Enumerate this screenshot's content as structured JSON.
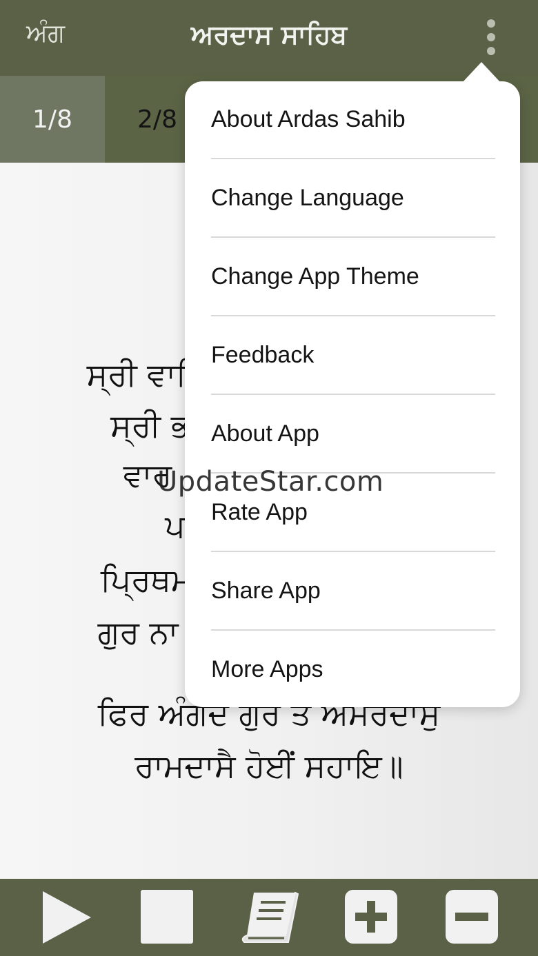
{
  "header": {
    "left_label": "ਅੰਗ",
    "title": "ਅਰਦਾਸ ਸਾਹਿਬ",
    "menu_icon": "more-vertical-icon"
  },
  "tabs": [
    {
      "label": "1/8",
      "active": true
    },
    {
      "label": "2/8",
      "active": false
    }
  ],
  "verse": {
    "lines": [
      "ਸ੍ਰੀ ਵਾਹਿ",
      "ਸ੍ਰੀ ਭ",
      "ਵਾਰ ",
      "ਪ",
      "ਪ੍ਰਿਥਮ",
      "ਗੁਰ ਨਾ",
      "ਫਿਰ ਅੰਗਦ ਗੁਰ ਤੇ ਅਮਰਦਾਸੁ",
      "ਰਾਮਦਾਸੈ ਹੋਈਂ ਸਹਾਇ॥"
    ]
  },
  "watermark": "UpdateStar.com",
  "menu": {
    "items": [
      "About Ardas Sahib",
      "Change Language",
      "Change App Theme",
      "Feedback",
      "About App",
      "Rate App",
      "Share App",
      "More Apps"
    ]
  },
  "bottom_bar": {
    "buttons": [
      "play-icon",
      "stop-icon",
      "book-icon",
      "plus-icon",
      "minus-icon"
    ]
  },
  "colors": {
    "header_bg": "#5a6147",
    "tab_active_bg": "#6f7661",
    "menu_bg": "#ffffff",
    "button_fill": "#f1f1f1"
  }
}
